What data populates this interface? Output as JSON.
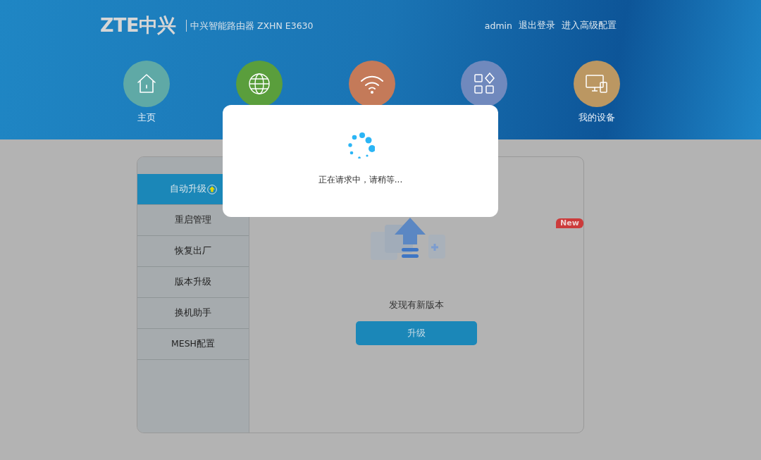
{
  "header": {
    "logo": "ZTE中兴",
    "product": "中兴智能路由器 ZXHN E3630",
    "user": "admin",
    "links": [
      "退出登录",
      "进入高级配置"
    ]
  },
  "nav": [
    {
      "kind": "home",
      "label": "主页",
      "color": "#5fa9a6"
    },
    {
      "kind": "globe",
      "color": "#5a9e3c"
    },
    {
      "kind": "wifi",
      "color": "#c47a59"
    },
    {
      "kind": "apps",
      "color": "#7089bd"
    },
    {
      "kind": "devices",
      "label": "我的设备",
      "color": "#bb9762"
    }
  ],
  "sidebar": {
    "items": [
      {
        "label": "自动升级",
        "selected": true,
        "badge": true
      },
      {
        "label": "重启管理",
        "selected": false,
        "badge": false
      },
      {
        "label": "恢复出厂",
        "selected": false,
        "badge": false
      },
      {
        "label": "版本升级",
        "selected": false,
        "badge": false
      },
      {
        "label": "换机助手",
        "selected": false,
        "badge": false
      },
      {
        "label": "MESH配置",
        "selected": false,
        "badge": false
      }
    ]
  },
  "content": {
    "badge": "New",
    "message": "发现有新版本",
    "button": "升级"
  },
  "modal": {
    "message": "正在请求中，请稍等..."
  }
}
